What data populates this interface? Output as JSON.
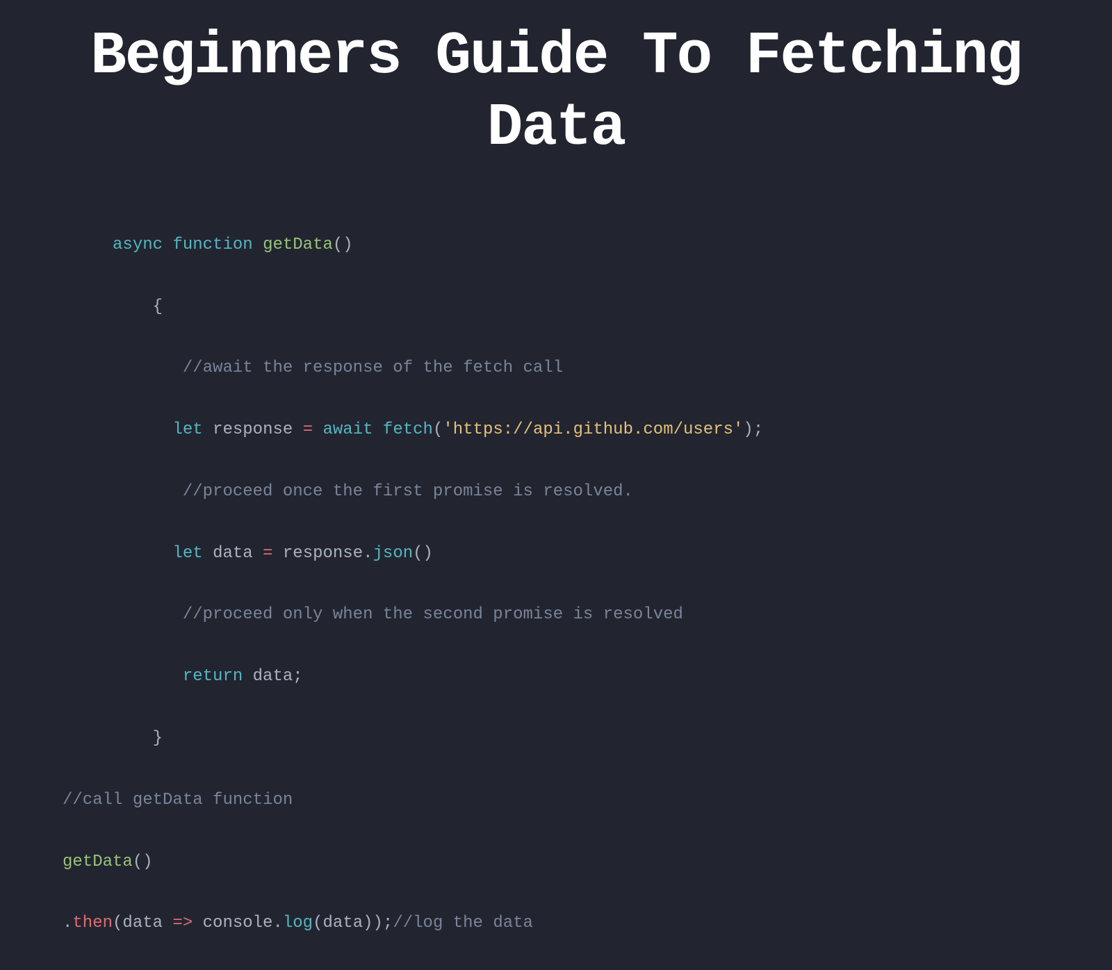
{
  "title": "Beginners Guide To Fetching Data",
  "code": {
    "line1": {
      "async": "async",
      "function": "function",
      "name": "getData",
      "parens": "()"
    },
    "line2": {
      "brace": "{"
    },
    "line3": {
      "comment": "//await the response of the fetch call"
    },
    "line4": {
      "let": "let",
      "var": "response",
      "eq": "=",
      "await": "await",
      "fetch": "fetch",
      "open": "(",
      "str": "'https://api.github.com/users'",
      "close": ");"
    },
    "line5": {
      "comment": "//proceed once the first promise is resolved."
    },
    "line6": {
      "let": "let",
      "var": "data",
      "eq": "=",
      "resp": "response",
      "dot": ".",
      "json": "json",
      "parens": "()"
    },
    "line7": {
      "comment": "//proceed only when the second promise is resolved"
    },
    "line8": {
      "return": "return",
      "var": "data",
      "semi": ";"
    },
    "line9": {
      "brace": "}"
    },
    "line10": {
      "comment": "//call getData function"
    },
    "line11": {
      "name": "getData",
      "parens": "()"
    },
    "line12": {
      "dot": ".",
      "then": "then",
      "open": "(",
      "param": "data",
      "arrow": " => ",
      "console": "console",
      "dot2": ".",
      "log": "log",
      "open2": "(",
      "param2": "data",
      "close": "));",
      "comment": "//log the data"
    }
  }
}
